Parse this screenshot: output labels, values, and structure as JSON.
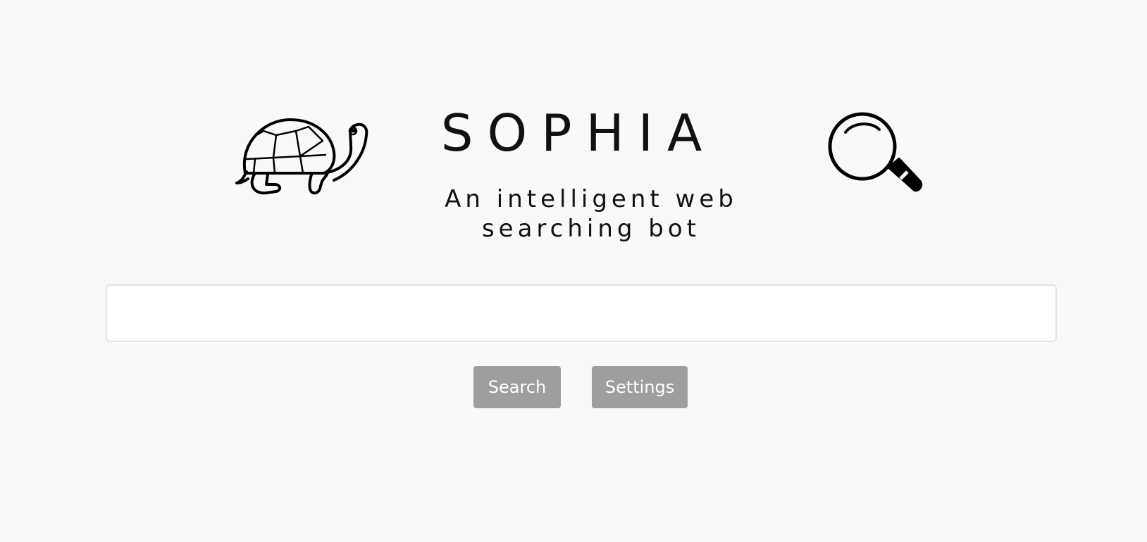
{
  "header": {
    "title": "SOPHIA",
    "subtitle": "An intelligent web searching bot"
  },
  "icons": {
    "left": "turtle-icon",
    "right": "magnifier-icon"
  },
  "search": {
    "value": "",
    "placeholder": ""
  },
  "actions": {
    "search_label": "Search",
    "settings_label": "Settings"
  },
  "colors": {
    "background": "#f9f9f9",
    "button": "#9e9e9e",
    "button_text": "#ffffff",
    "text": "#111111"
  }
}
